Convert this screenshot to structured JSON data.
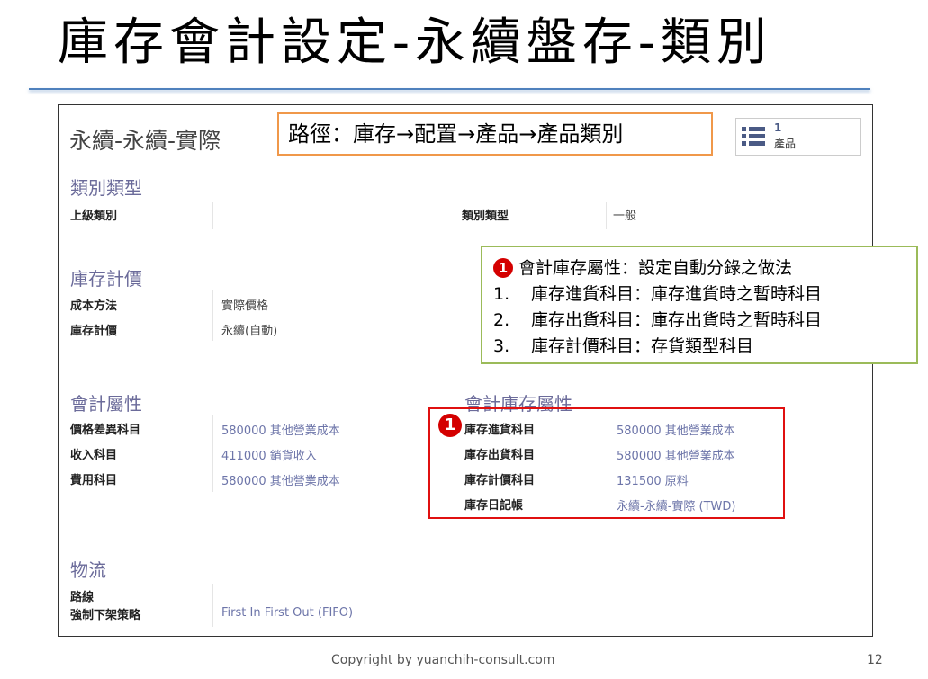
{
  "slide": {
    "title": "庫存會計設定-永續盤存-類別",
    "footer": "Copyright  by yuanchih-consult.com",
    "page_number": "12"
  },
  "form": {
    "record_name": "永續-永續-實際",
    "path": "路徑：庫存→配置→產品→產品類別",
    "stat_button": {
      "count": "1",
      "label": "產品",
      "icon": "list-icon"
    },
    "category_section": {
      "title": "類別類型",
      "parent_label": "上級類別",
      "parent_value": "",
      "type_label": "類別類型",
      "type_value": "一般"
    },
    "valuation_section": {
      "title": "庫存計價",
      "cost_method_label": "成本方法",
      "cost_method_value": "實際價格",
      "valuation_label": "庫存計價",
      "valuation_value": "永續(自動)"
    },
    "accounting_section": {
      "title": "會計屬性",
      "price_diff_label": "價格差異科目",
      "price_diff_value": "580000 其他營業成本",
      "income_label": "收入科目",
      "income_value": "411000 銷貨收入",
      "expense_label": "費用科目",
      "expense_value": "580000 其他營業成本"
    },
    "stock_accounting_section": {
      "title": "會計庫存屬性",
      "input_label": "庫存進貨科目",
      "input_value": "580000 其他營業成本",
      "output_label": "庫存出貨科目",
      "output_value": "580000 其他營業成本",
      "valuation_account_label": "庫存計價科目",
      "valuation_account_value": "131500 原料",
      "journal_label": "庫存日記帳",
      "journal_value": "永續-永續-實際 (TWD)"
    },
    "logistics_section": {
      "title": "物流",
      "routes_label": "路線",
      "removal_label": "強制下架策略",
      "removal_value": "First In First Out (FIFO)"
    }
  },
  "annotation": {
    "badge": "1",
    "heading": "會計庫存屬性：設定自動分錄之做法",
    "items": [
      {
        "num": "1.",
        "text": "庫存進貨科目：庫存進貨時之暫時科目"
      },
      {
        "num": "2.",
        "text": "庫存出貨科目：庫存出貨時之暫時科目"
      },
      {
        "num": "3.",
        "text": "庫存計價科目：存貨類型科目"
      }
    ]
  },
  "colors": {
    "title_rule": "#4f81bd",
    "path_box_border": "#f0984a",
    "note_box_border": "#9bbb59",
    "highlight_border": "#e01010",
    "section_title": "#6b6b9a",
    "link_text": "#6d75a9"
  }
}
